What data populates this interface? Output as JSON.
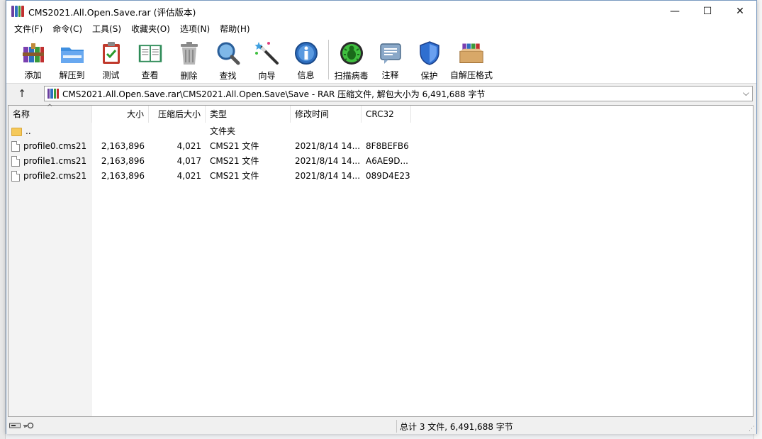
{
  "window": {
    "title": "CMS2021.All.Open.Save.rar (评估版本)",
    "controls": {
      "minimize": "—",
      "maximize": "☐",
      "close": "✕"
    }
  },
  "menu": [
    "文件(F)",
    "命令(C)",
    "工具(S)",
    "收藏夹(O)",
    "选项(N)",
    "帮助(H)"
  ],
  "toolbar": {
    "add": "添加",
    "extract": "解压到",
    "test": "测试",
    "view": "查看",
    "delete": "删除",
    "find": "查找",
    "wizard": "向导",
    "info": "信息",
    "scan": "扫描病毒",
    "comment": "注释",
    "protect": "保护",
    "sfx": "自解压格式"
  },
  "address": {
    "up": "↑",
    "path": "CMS2021.All.Open.Save.rar\\CMS2021.All.Open.Save\\Save - RAR 压缩文件, 解包大小为 6,491,688 字节",
    "dropdown": "⌵"
  },
  "columns": {
    "name": "名称",
    "size": "大小",
    "packed": "压缩后大小",
    "type": "类型",
    "modified": "修改时间",
    "crc": "CRC32"
  },
  "rows": [
    {
      "name": "..",
      "size": "",
      "packed": "",
      "type": "文件夹",
      "modified": "",
      "crc": ""
    },
    {
      "name": "profile0.cms21",
      "size": "2,163,896",
      "packed": "4,021",
      "type": "CMS21 文件",
      "modified": "2021/8/14 14...",
      "crc": "8F8BEFB6"
    },
    {
      "name": "profile1.cms21",
      "size": "2,163,896",
      "packed": "4,017",
      "type": "CMS21 文件",
      "modified": "2021/8/14 14...",
      "crc": "A6AE9D..."
    },
    {
      "name": "profile2.cms21",
      "size": "2,163,896",
      "packed": "4,021",
      "type": "CMS21 文件",
      "modified": "2021/8/14 14...",
      "crc": "089D4E23"
    }
  ],
  "status": {
    "summary": "总计 3 文件, 6,491,688 字节"
  }
}
